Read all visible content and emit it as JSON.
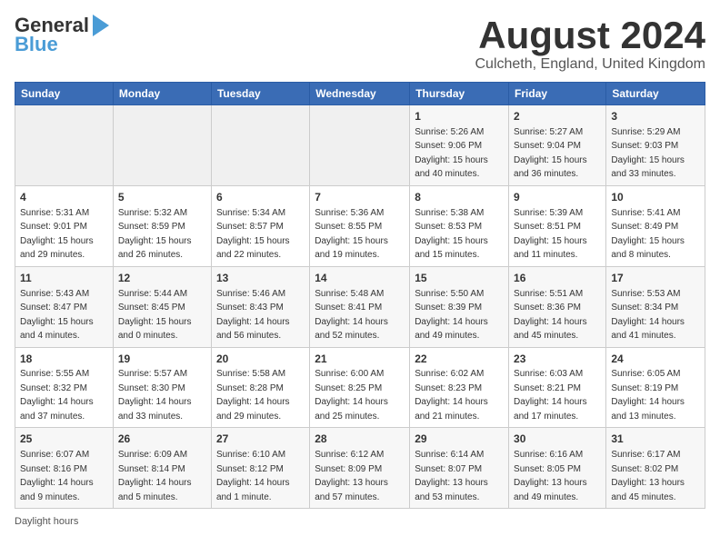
{
  "header": {
    "logo_top": "General",
    "logo_bottom": "Blue",
    "month_title": "August 2024",
    "location": "Culcheth, England, United Kingdom"
  },
  "days_of_week": [
    "Sunday",
    "Monday",
    "Tuesday",
    "Wednesday",
    "Thursday",
    "Friday",
    "Saturday"
  ],
  "weeks": [
    [
      {
        "day": "",
        "info": ""
      },
      {
        "day": "",
        "info": ""
      },
      {
        "day": "",
        "info": ""
      },
      {
        "day": "",
        "info": ""
      },
      {
        "day": "1",
        "info": "Sunrise: 5:26 AM\nSunset: 9:06 PM\nDaylight: 15 hours\nand 40 minutes."
      },
      {
        "day": "2",
        "info": "Sunrise: 5:27 AM\nSunset: 9:04 PM\nDaylight: 15 hours\nand 36 minutes."
      },
      {
        "day": "3",
        "info": "Sunrise: 5:29 AM\nSunset: 9:03 PM\nDaylight: 15 hours\nand 33 minutes."
      }
    ],
    [
      {
        "day": "4",
        "info": "Sunrise: 5:31 AM\nSunset: 9:01 PM\nDaylight: 15 hours\nand 29 minutes."
      },
      {
        "day": "5",
        "info": "Sunrise: 5:32 AM\nSunset: 8:59 PM\nDaylight: 15 hours\nand 26 minutes."
      },
      {
        "day": "6",
        "info": "Sunrise: 5:34 AM\nSunset: 8:57 PM\nDaylight: 15 hours\nand 22 minutes."
      },
      {
        "day": "7",
        "info": "Sunrise: 5:36 AM\nSunset: 8:55 PM\nDaylight: 15 hours\nand 19 minutes."
      },
      {
        "day": "8",
        "info": "Sunrise: 5:38 AM\nSunset: 8:53 PM\nDaylight: 15 hours\nand 15 minutes."
      },
      {
        "day": "9",
        "info": "Sunrise: 5:39 AM\nSunset: 8:51 PM\nDaylight: 15 hours\nand 11 minutes."
      },
      {
        "day": "10",
        "info": "Sunrise: 5:41 AM\nSunset: 8:49 PM\nDaylight: 15 hours\nand 8 minutes."
      }
    ],
    [
      {
        "day": "11",
        "info": "Sunrise: 5:43 AM\nSunset: 8:47 PM\nDaylight: 15 hours\nand 4 minutes."
      },
      {
        "day": "12",
        "info": "Sunrise: 5:44 AM\nSunset: 8:45 PM\nDaylight: 15 hours\nand 0 minutes."
      },
      {
        "day": "13",
        "info": "Sunrise: 5:46 AM\nSunset: 8:43 PM\nDaylight: 14 hours\nand 56 minutes."
      },
      {
        "day": "14",
        "info": "Sunrise: 5:48 AM\nSunset: 8:41 PM\nDaylight: 14 hours\nand 52 minutes."
      },
      {
        "day": "15",
        "info": "Sunrise: 5:50 AM\nSunset: 8:39 PM\nDaylight: 14 hours\nand 49 minutes."
      },
      {
        "day": "16",
        "info": "Sunrise: 5:51 AM\nSunset: 8:36 PM\nDaylight: 14 hours\nand 45 minutes."
      },
      {
        "day": "17",
        "info": "Sunrise: 5:53 AM\nSunset: 8:34 PM\nDaylight: 14 hours\nand 41 minutes."
      }
    ],
    [
      {
        "day": "18",
        "info": "Sunrise: 5:55 AM\nSunset: 8:32 PM\nDaylight: 14 hours\nand 37 minutes."
      },
      {
        "day": "19",
        "info": "Sunrise: 5:57 AM\nSunset: 8:30 PM\nDaylight: 14 hours\nand 33 minutes."
      },
      {
        "day": "20",
        "info": "Sunrise: 5:58 AM\nSunset: 8:28 PM\nDaylight: 14 hours\nand 29 minutes."
      },
      {
        "day": "21",
        "info": "Sunrise: 6:00 AM\nSunset: 8:25 PM\nDaylight: 14 hours\nand 25 minutes."
      },
      {
        "day": "22",
        "info": "Sunrise: 6:02 AM\nSunset: 8:23 PM\nDaylight: 14 hours\nand 21 minutes."
      },
      {
        "day": "23",
        "info": "Sunrise: 6:03 AM\nSunset: 8:21 PM\nDaylight: 14 hours\nand 17 minutes."
      },
      {
        "day": "24",
        "info": "Sunrise: 6:05 AM\nSunset: 8:19 PM\nDaylight: 14 hours\nand 13 minutes."
      }
    ],
    [
      {
        "day": "25",
        "info": "Sunrise: 6:07 AM\nSunset: 8:16 PM\nDaylight: 14 hours\nand 9 minutes."
      },
      {
        "day": "26",
        "info": "Sunrise: 6:09 AM\nSunset: 8:14 PM\nDaylight: 14 hours\nand 5 minutes."
      },
      {
        "day": "27",
        "info": "Sunrise: 6:10 AM\nSunset: 8:12 PM\nDaylight: 14 hours\nand 1 minute."
      },
      {
        "day": "28",
        "info": "Sunrise: 6:12 AM\nSunset: 8:09 PM\nDaylight: 13 hours\nand 57 minutes."
      },
      {
        "day": "29",
        "info": "Sunrise: 6:14 AM\nSunset: 8:07 PM\nDaylight: 13 hours\nand 53 minutes."
      },
      {
        "day": "30",
        "info": "Sunrise: 6:16 AM\nSunset: 8:05 PM\nDaylight: 13 hours\nand 49 minutes."
      },
      {
        "day": "31",
        "info": "Sunrise: 6:17 AM\nSunset: 8:02 PM\nDaylight: 13 hours\nand 45 minutes."
      }
    ]
  ],
  "footer": {
    "daylight_label": "Daylight hours"
  }
}
